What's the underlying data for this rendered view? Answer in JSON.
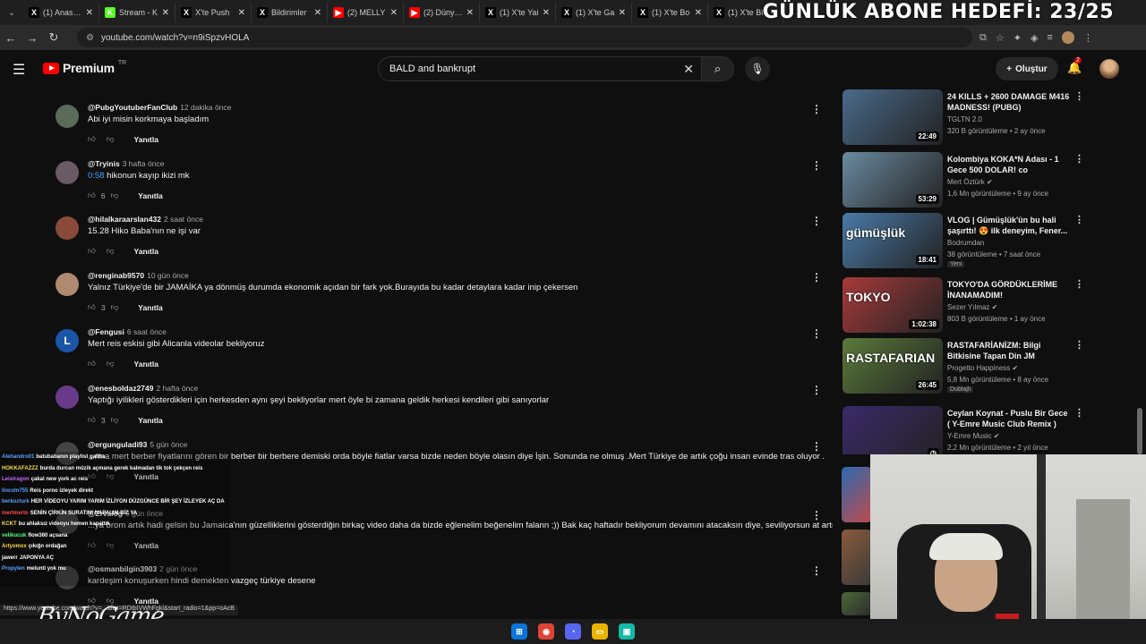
{
  "overlay": {
    "goal": "GÜNLÜK ABONE HEDEFİ: 23/25"
  },
  "tabs": [
    {
      "label": "(1) Anasayfa",
      "icon": "x-icon",
      "color": "#000000"
    },
    {
      "label": "Stream - K",
      "icon": "kick-icon",
      "color": "#53fc18"
    },
    {
      "label": "X'te Push",
      "icon": "x-icon",
      "color": "#000000"
    },
    {
      "label": "Bildirimler",
      "icon": "x-icon",
      "color": "#000000"
    },
    {
      "label": "(2) MELLY",
      "icon": "youtube-icon",
      "color": "#ff0000"
    },
    {
      "label": "(2) Dünyan",
      "icon": "youtube-icon",
      "color": "#ff0000"
    },
    {
      "label": "(1) X'te Yai",
      "icon": "x-icon",
      "color": "#000000"
    },
    {
      "label": "(1) X'te Ga",
      "icon": "x-icon",
      "color": "#000000"
    },
    {
      "label": "(1) X'te Bo",
      "icon": "x-icon",
      "color": "#000000"
    },
    {
      "label": "(1) X'te Bi",
      "icon": "x-icon",
      "color": "#000000"
    }
  ],
  "browser": {
    "url": "youtube.com/watch?v=n9iSpzvHOLA"
  },
  "header": {
    "logo": "Premium",
    "region": "TR",
    "search_value": "BALD and bankrupt",
    "create_label": "Oluştur",
    "notif_count": "2"
  },
  "comments": [
    {
      "user": "@PubgYoutuberFanClub",
      "time": "12 dakika önce",
      "text": "Abi iyi misin korkmaya başladım",
      "likes": "",
      "reply": "Yanıtla",
      "avatar_color": "#5a6b5a",
      "avatar_letter": ""
    },
    {
      "user": "@Tryinis",
      "time": "3 hafta önce",
      "ts": "0:58",
      "text": "hikonun kayıp ikizi mk",
      "likes": "6",
      "reply": "Yanıtla",
      "avatar_color": "#6a5a66",
      "avatar_letter": ""
    },
    {
      "user": "@hilalkaraarslan432",
      "time": "2 saat önce",
      "text": "15.28 Hiko Baba'nın ne işi var",
      "likes": "",
      "reply": "Yanıtla",
      "avatar_color": "#8a4a3a",
      "avatar_letter": ""
    },
    {
      "user": "@renginab9570",
      "time": "10 gün önce",
      "text": "Yalnız Türkiye'de bir JAMAİKA ya dönmüş durumda ekonomik açıdan bir fark yok.Burayıda bu kadar detaylara kadar inip çekersen",
      "likes": "3",
      "reply": "Yanıtla",
      "avatar_color": "#b08a70",
      "avatar_letter": ""
    },
    {
      "user": "@Fengusi",
      "time": "6 saat önce",
      "text": "Mert reis eskisi gibi Alicanla videolar bekliyoruz",
      "likes": "",
      "reply": "Yanıtla",
      "avatar_color": "#1a56a8",
      "avatar_letter": "L"
    },
    {
      "user": "@enesboldaz2749",
      "time": "2 hafta önce",
      "text": "Yaptığı iyilikleri gösterdikleri için herkesden aynı şeyi bekliyorlar mert öyle bi zamana geldik herkesi kendileri gibi sanıyorlar",
      "likes": "3",
      "reply": "Yanıtla",
      "avatar_color": "#6a3a8a",
      "avatar_letter": ""
    },
    {
      "user": "@ergunguladi93",
      "time": "5 gün önce",
      "text": "...rma mert berber fiyatlarını gören bir berber bir berbere demiski orda böyle fiatlar varsa bizde neden böyle olasın diye İşin. Sonunda ne olmuş .Mert Türkiye de artık çoğu insan evinde tras oluyor .",
      "likes": "",
      "reply": "Yanıtla",
      "avatar_color": "#444444",
      "avatar_letter": ""
    },
    {
      "user": "@Zrvalog",
      "time": "9 gün önce",
      "text": "...ya brom artık hadi gelsin bu Jamaica'nın güzelliklerini gösterdiğin birkaç video daha da bizde eğlenelim beğenelim falann ;)) Bak kaç haftadır bekliyorum devamını atacaksın diye, seviliyorsun at artık..",
      "likes": "",
      "reply": "Yanıtla",
      "avatar_color": "#444444",
      "avatar_letter": ""
    },
    {
      "user": "@osmanbilgin3903",
      "time": "2 gün önce",
      "text": "kardeşim konuşurken hindi demekten vazgeç türkiye desene",
      "likes": "",
      "reply": "Yanıtla",
      "avatar_color": "#444444",
      "avatar_letter": ""
    }
  ],
  "sidebar": [
    {
      "title": "24 KILLS + 2600 DAMAGE M416 MADNESS! (PUBG)",
      "channel": "TGLTN 2.0",
      "stats": "320 B görüntüleme • 2 ay önce",
      "duration": "22:49",
      "verified": false,
      "tag": "",
      "thumb_text": "",
      "bg": "#4a6a8a"
    },
    {
      "title": "Kolombiya KOKA*N Adası - 1 Gece 500 DOLAR! co",
      "channel": "Mert Öztürk",
      "stats": "1,6 Mn görüntüleme • 9 ay önce",
      "duration": "53:29",
      "verified": true,
      "tag": "",
      "thumb_text": "",
      "bg": "#6a8aa0"
    },
    {
      "title": "VLOG | Gümüşlük'ün bu hali şaşırttı! 😍 ilk deneyim, Fener...",
      "channel": "Bodrumdan",
      "stats": "38 görüntüleme • 7 saat önce",
      "duration": "18:41",
      "verified": false,
      "tag": "Yeni",
      "thumb_text": "gümüşlük",
      "bg": "#4a7aa8"
    },
    {
      "title": "TOKYO'DA GÖRDÜKLERİME İNANAMADIM!",
      "channel": "Sezer Yılmaz",
      "stats": "803 B görüntüleme • 1 ay önce",
      "duration": "1:02:38",
      "verified": true,
      "tag": "",
      "thumb_text": "TOKYO",
      "bg": "#a83a3a"
    },
    {
      "title": "RASTAFARİANİZM: Bilgi Bitkisine Tapan Din JM",
      "channel": "Progetto Happiness",
      "stats": "5,8 Mn görüntüleme • 8 ay önce",
      "duration": "26:45",
      "verified": true,
      "tag": "Dublajlı",
      "thumb_text": "RASTAFARIAN",
      "bg": "#5a7a3a"
    },
    {
      "title": "Ceylan Koynat - Puslu Bir Gece ( Y-Emre Music Club Remix )",
      "channel": "Y-Emre Music",
      "stats": "2,2 Mn görüntüleme • 2 yıl önce",
      "duration": "",
      "verified": true,
      "tag": "",
      "thumb_text": "",
      "bg": "#3a2a6a"
    }
  ],
  "chat": [
    {
      "name": "Alehandro01",
      "msg": "batubabanın playlist galiba",
      "color": "#5aa0ff"
    },
    {
      "name": "HOKKAFAZZZ",
      "msg": "burda durcan müzik açmana gerek kalmadan tik tok çekçen reis",
      "color": "#ffd84a"
    },
    {
      "name": "Leistragon",
      "msg": "çakal new york ac reis",
      "color": "#c06aff"
    },
    {
      "name": "lincoln755",
      "msg": "Reis porno izleyek direkt",
      "color": "#5aa0ff"
    },
    {
      "name": "berkozturk",
      "msg": "HER VİDEOYU YARIM YARIM İZLİYON DÜZGÜNCE BİR ŞEY İZLEYEK AÇ DA",
      "color": "#5aa0ff"
    },
    {
      "name": "mertmerto",
      "msg": "SENİN ÇİRKİN SURATINI NAPALIM BİZ YA",
      "color": "#ff4a4a"
    },
    {
      "name": "KCKT",
      "msg": "bu ahlaksız videoyu hemen kapattık",
      "color": "#ffd84a"
    },
    {
      "name": "velikucuk",
      "msg": "flow360 açsana",
      "color": "#5aff7a"
    },
    {
      "name": "Artyomxx",
      "msg": "çıkığn ordağan",
      "color": "#ffd84a"
    },
    {
      "name": "jawerr",
      "msg": "JAPONYA AÇ",
      "color": "#ffffff"
    },
    {
      "name": "Propylen",
      "msg": "melunti yok mu",
      "color": "#5aa0ff"
    }
  ],
  "status_url": "https://www.youtube.com/watch?v=...&list=RDtbIVWhFgkl&start_radio=1&pp=oAcB",
  "brand": "ByNoGame",
  "taskbar": [
    "windows-icon",
    "chrome-icon",
    "discord-icon",
    "folder-icon",
    "app-icon"
  ]
}
